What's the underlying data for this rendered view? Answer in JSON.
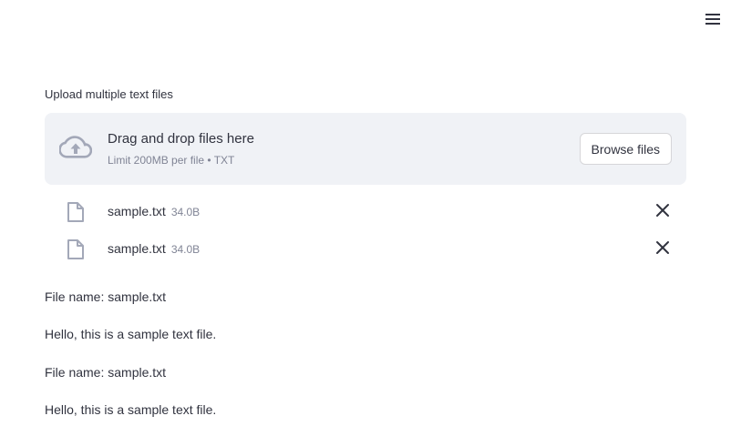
{
  "header": {
    "menu_icon": "hamburger-menu-icon"
  },
  "uploader": {
    "label": "Upload multiple text files",
    "drop_title": "Drag and drop files here",
    "drop_subtitle": "Limit 200MB per file • TXT",
    "upload_icon": "cloud-upload-icon",
    "browse_label": "Browse files"
  },
  "files": [
    {
      "name": "sample.txt",
      "size": "34.0B",
      "icon": "file-icon",
      "remove_icon": "close-icon"
    },
    {
      "name": "sample.txt",
      "size": "34.0B",
      "icon": "file-icon",
      "remove_icon": "close-icon"
    }
  ],
  "outputs": [
    "File name: sample.txt",
    "Hello, this is a sample text file.",
    "File name: sample.txt",
    "Hello, this is a sample text file."
  ],
  "colors": {
    "text": "#31333f",
    "muted": "#808495",
    "dropzone_bg": "#f0f2f6",
    "border": "#d6d6d9"
  }
}
